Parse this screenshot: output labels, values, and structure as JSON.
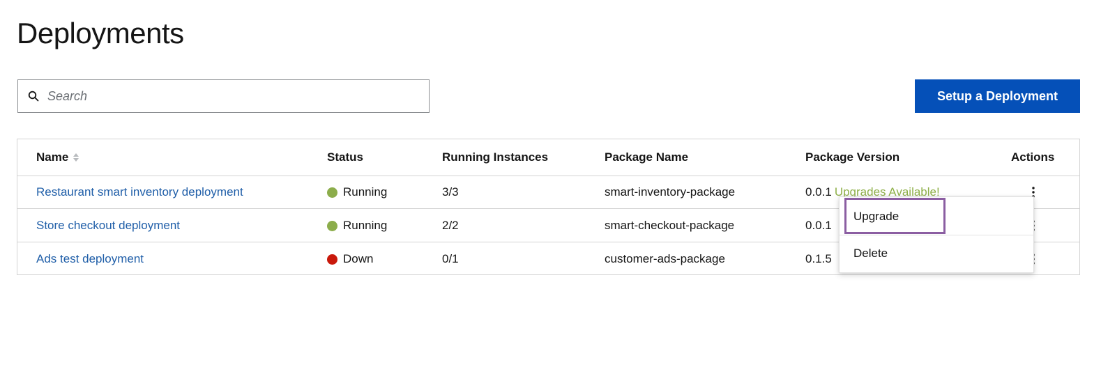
{
  "page": {
    "title": "Deployments"
  },
  "search": {
    "placeholder": "Search",
    "icon": "search-icon"
  },
  "toolbar": {
    "primary_button_label": "Setup a Deployment"
  },
  "table": {
    "columns": {
      "name": "Name",
      "status": "Status",
      "instances": "Running Instances",
      "package_name": "Package Name",
      "package_version": "Package Version",
      "actions": "Actions"
    },
    "rows": [
      {
        "name": "Restaurant smart inventory deployment",
        "status": "Running",
        "status_color": "#8cad4b",
        "instances": "3/3",
        "package_name": "smart-inventory-package",
        "package_version": "0.0.1",
        "upgrade_notice": "Upgrades Available!"
      },
      {
        "name": "Store checkout deployment",
        "status": "Running",
        "status_color": "#8cad4b",
        "instances": "2/2",
        "package_name": "smart-checkout-package",
        "package_version": "0.0.1",
        "upgrade_notice": ""
      },
      {
        "name": "Ads test deployment",
        "status": "Down",
        "status_color": "#c9190b",
        "instances": "0/1",
        "package_name": "customer-ads-package",
        "package_version": "0.1.5",
        "upgrade_notice": ""
      }
    ]
  },
  "actions_menu": {
    "upgrade_label": "Upgrade",
    "delete_label": "Delete"
  },
  "colors": {
    "primary": "#0550b8",
    "link": "#1f5ea8",
    "success": "#8cad4b",
    "danger": "#c9190b",
    "highlight": "#8b5ea2"
  }
}
